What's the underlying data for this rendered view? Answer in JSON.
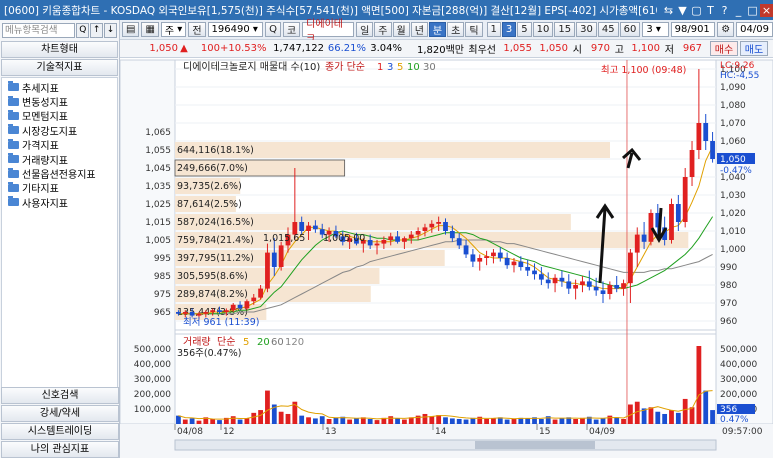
{
  "window": {
    "title": "[0600] 키움종합차트 - KOSDAQ 외국인보유[1,575(천)] 주식수[57,541(천)] 액면[500] 자본금[288(억)] 결산[12월] EPS[-402] 시가총액[610(억)]",
    "buttons": [
      "⇆",
      "▼",
      "▢",
      "T",
      "?",
      "_",
      "□",
      "×"
    ]
  },
  "left_panel": {
    "search_placeholder": "메뉴항목검색",
    "search_btn": "Q",
    "up_btn": "↑",
    "down_btn": "↓",
    "chart_type_label": "차트형태",
    "tech_indicator_label": "기술적지표",
    "tree_items": [
      "추세지표",
      "변동성지표",
      "모멘텀지표",
      "시장강도지표",
      "가격지표",
      "거래량지표",
      "선물옵션전용지표",
      "기타지표",
      "사용자지표"
    ],
    "bottom_buttons": [
      "신호검색",
      "강세/약세",
      "시스템트레이딩",
      "나의 관심지표"
    ]
  },
  "toolbar1": {
    "icons": [
      "▤",
      "▦"
    ],
    "period": "주",
    "period2": "전",
    "code": "196490",
    "search_icon": "Q",
    "market": "코",
    "name": "디에이테크",
    "intervals": [
      "일",
      "주",
      "월",
      "년",
      "분",
      "초",
      "틱"
    ],
    "selected_interval": "분",
    "minute_options": [
      "1",
      "3",
      "5",
      "10",
      "15",
      "30",
      "45",
      "60"
    ],
    "selected_minute": "3",
    "count": "3",
    "page": "98/901",
    "date": "04/09"
  },
  "toolbar2": {
    "price": "1,050",
    "change_arrow": "▲",
    "change": "100",
    "change_pct": "+10.53%",
    "volume": "1,747,122",
    "vol_ratio": "66.21%",
    "turnover": "3.04%",
    "amount": "1,820백만",
    "best_label": "최우선",
    "ask": "1,055",
    "bid": "1,050",
    "open_label": "시",
    "open": "970",
    "high_label": "고",
    "high": "1,100",
    "low_label": "저",
    "low": "967",
    "buy_label": "매수",
    "sell_label": "매도"
  },
  "chart": {
    "legend_title": "디에이테크놀로지 매물대 수(10)",
    "ma_label": "종가 단순",
    "ma_periods": [
      "1",
      "3",
      "5",
      "10",
      "30"
    ],
    "ma_colors": [
      "#e02020",
      "#1a4fd1",
      "#e0a000",
      "#20a020",
      "#777777"
    ],
    "high_note": "최고 1,100 (09:48)",
    "low_note": "최저 961 (11:39)",
    "lc_label": "LC:9,26",
    "hc_label": "HC:-4,55",
    "price_ticks": [
      "1,100",
      "1,090",
      "1,080",
      "1,070",
      "1,060",
      "1,050",
      "1,040",
      "1,030",
      "1,020",
      "1,010",
      "1,000",
      "990",
      "980",
      "970",
      "960"
    ],
    "left_ticks": [
      "1,065",
      "1,055",
      "1,045",
      "1,035",
      "1,025",
      "1,015",
      "1,005",
      "995",
      "985",
      "975",
      "965"
    ],
    "current_price_tag": "1,050",
    "current_pct_tag": "-0.47%",
    "volume_profile": [
      {
        "label": "644,116(18.1%)",
        "price": 1055,
        "ratio": 1.0
      },
      {
        "label": "249,666(7.0%)",
        "price": 1045,
        "ratio": 0.39
      },
      {
        "label": "93,735(2.6%)",
        "price": 1035,
        "ratio": 0.15
      },
      {
        "label": "87,614(2.5%)",
        "price": 1025,
        "ratio": 0.14
      },
      {
        "label": "587,024(16.5%)",
        "price": 1015,
        "ratio": 0.91
      },
      {
        "label": "759,784(21.4%)",
        "price": 1005,
        "ratio": 1.18
      },
      {
        "label": "397,795(11.2%)",
        "price": 995,
        "ratio": 0.62
      },
      {
        "label": "305,595(8.6%)",
        "price": 985,
        "ratio": 0.47
      },
      {
        "label": "289,874(8.2%)",
        "price": 975,
        "ratio": 0.45
      },
      {
        "label": "135,447(3.8%)",
        "price": 965,
        "ratio": 0.21
      }
    ],
    "inline_labels": [
      "1,015,65",
      "1,005,00"
    ],
    "volume_legend": "거래량",
    "volume_ma_label": "단순",
    "volume_ma_periods": [
      "5",
      "20",
      "60",
      "120"
    ],
    "volume_ma_colors": [
      "#e0a000",
      "#20a020",
      "#777777"
    ],
    "volume_note": "356주(0.47%)",
    "volume_ticks": [
      "500,000",
      "400,000",
      "300,000",
      "200,000",
      "100,000"
    ],
    "volume_tag": "356",
    "volume_pct_tag": "0.47%",
    "x_labels": [
      "04/08",
      "12",
      "13",
      "14",
      "15",
      "04/09"
    ],
    "time_label": "09:57:00"
  },
  "chart_data": {
    "type": "candlestick",
    "ylim": [
      955,
      1105
    ],
    "candles": [
      [
        965,
        966,
        963,
        964
      ],
      [
        964,
        966,
        962,
        965
      ],
      [
        965,
        967,
        962,
        963
      ],
      [
        963,
        965,
        961,
        964
      ],
      [
        964,
        966,
        962,
        965
      ],
      [
        965,
        967,
        963,
        966
      ],
      [
        966,
        968,
        964,
        965
      ],
      [
        965,
        967,
        963,
        966
      ],
      [
        966,
        970,
        965,
        969
      ],
      [
        969,
        971,
        966,
        967
      ],
      [
        967,
        972,
        966,
        971
      ],
      [
        971,
        975,
        969,
        973
      ],
      [
        973,
        980,
        972,
        978
      ],
      [
        978,
        1003,
        976,
        998
      ],
      [
        998,
        1006,
        985,
        990
      ],
      [
        990,
        1004,
        988,
        1002
      ],
      [
        1002,
        1012,
        998,
        1008
      ],
      [
        1008,
        1045,
        1005,
        1015
      ],
      [
        1015,
        1018,
        1008,
        1010
      ],
      [
        1010,
        1015,
        1005,
        1013
      ],
      [
        1013,
        1016,
        1009,
        1011
      ],
      [
        1011,
        1014,
        1006,
        1008
      ],
      [
        1008,
        1012,
        1004,
        1010
      ],
      [
        1010,
        1013,
        1006,
        1007
      ],
      [
        1007,
        1010,
        1002,
        1004
      ],
      [
        1004,
        1008,
        1000,
        1006
      ],
      [
        1006,
        1009,
        1002,
        1003
      ],
      [
        1003,
        1006,
        998,
        1005
      ],
      [
        1005,
        1008,
        1000,
        1002
      ],
      [
        1002,
        1005,
        997,
        1003
      ],
      [
        1003,
        1007,
        1000,
        1005
      ],
      [
        1005,
        1009,
        1002,
        1007
      ],
      [
        1007,
        1010,
        1003,
        1004
      ],
      [
        1004,
        1007,
        1000,
        1006
      ],
      [
        1006,
        1010,
        1003,
        1008
      ],
      [
        1008,
        1012,
        1005,
        1010
      ],
      [
        1010,
        1014,
        1007,
        1012
      ],
      [
        1012,
        1016,
        1009,
        1014
      ],
      [
        1014,
        1018,
        1010,
        1015
      ],
      [
        1015,
        1017,
        1008,
        1010
      ],
      [
        1010,
        1013,
        1004,
        1006
      ],
      [
        1006,
        1009,
        1000,
        1002
      ],
      [
        1002,
        1005,
        995,
        997
      ],
      [
        997,
        1000,
        990,
        993
      ],
      [
        993,
        997,
        988,
        995
      ],
      [
        995,
        999,
        991,
        996
      ],
      [
        996,
        1000,
        992,
        998
      ],
      [
        998,
        1001,
        993,
        995
      ],
      [
        995,
        998,
        989,
        991
      ],
      [
        991,
        995,
        987,
        993
      ],
      [
        993,
        996,
        988,
        990
      ],
      [
        990,
        994,
        985,
        988
      ],
      [
        988,
        992,
        983,
        986
      ],
      [
        986,
        990,
        980,
        983
      ],
      [
        983,
        987,
        978,
        981
      ],
      [
        981,
        986,
        976,
        984
      ],
      [
        984,
        988,
        979,
        982
      ],
      [
        982,
        986,
        975,
        978
      ],
      [
        978,
        983,
        972,
        980
      ],
      [
        980,
        985,
        976,
        982
      ],
      [
        982,
        988,
        977,
        979
      ],
      [
        979,
        984,
        974,
        977
      ],
      [
        977,
        982,
        970,
        975
      ],
      [
        975,
        982,
        972,
        980
      ],
      [
        980,
        985,
        976,
        978
      ],
      [
        978,
        983,
        974,
        981
      ],
      [
        981,
        1000,
        970,
        998
      ],
      [
        998,
        1012,
        990,
        1008
      ],
      [
        1008,
        1015,
        1000,
        1004
      ],
      [
        1004,
        1022,
        1002,
        1020
      ],
      [
        1020,
        1025,
        1008,
        1012
      ],
      [
        1012,
        1018,
        1002,
        1005
      ],
      [
        1005,
        1028,
        1003,
        1025
      ],
      [
        1025,
        1030,
        1010,
        1015
      ],
      [
        1015,
        1045,
        1012,
        1040
      ],
      [
        1040,
        1060,
        1035,
        1055
      ],
      [
        1055,
        1100,
        1050,
        1070
      ],
      [
        1070,
        1075,
        1055,
        1060
      ],
      [
        1060,
        1065,
        1048,
        1050
      ]
    ],
    "volumes": [
      15,
      8,
      10,
      6,
      12,
      9,
      7,
      11,
      14,
      8,
      10,
      20,
      25,
      60,
      35,
      22,
      18,
      40,
      15,
      12,
      10,
      14,
      9,
      11,
      13,
      8,
      10,
      12,
      9,
      7,
      11,
      14,
      10,
      8,
      12,
      15,
      18,
      14,
      16,
      12,
      10,
      9,
      8,
      11,
      13,
      9,
      10,
      12,
      8,
      9,
      11,
      10,
      12,
      9,
      14,
      8,
      10,
      12,
      9,
      11,
      13,
      8,
      10,
      15,
      12,
      9,
      35,
      40,
      28,
      30,
      22,
      18,
      25,
      20,
      45,
      30,
      140,
      60,
      25
    ],
    "ma5": [
      964,
      964,
      964,
      964,
      964,
      965,
      965,
      965,
      966,
      967,
      968,
      970,
      972,
      980,
      985,
      991,
      999,
      1004,
      1008,
      1012,
      1012,
      1011,
      1010,
      1010,
      1008,
      1007,
      1006,
      1005,
      1004,
      1004,
      1004,
      1004,
      1005,
      1005,
      1006,
      1007,
      1009,
      1011,
      1013,
      1013,
      1012,
      1009,
      1006,
      1002,
      998,
      996,
      995,
      995,
      995,
      994,
      993,
      992,
      990,
      987,
      984,
      983,
      982,
      981,
      981,
      980,
      980,
      979,
      978,
      978,
      978,
      978,
      983,
      990,
      997,
      1004,
      1008,
      1009,
      1012,
      1013,
      1018,
      1026,
      1035,
      1049,
      1057
    ],
    "ma10": [
      964,
      964,
      964,
      964,
      964,
      964,
      964,
      965,
      965,
      966,
      966,
      967,
      968,
      972,
      976,
      979,
      984,
      989,
      994,
      998,
      1002,
      1005,
      1007,
      1009,
      1010,
      1009,
      1008,
      1008,
      1007,
      1006,
      1006,
      1005,
      1005,
      1005,
      1005,
      1005,
      1006,
      1007,
      1008,
      1009,
      1009,
      1009,
      1009,
      1008,
      1006,
      1005,
      1003,
      1001,
      999,
      997,
      995,
      994,
      993,
      991,
      990,
      989,
      988,
      987,
      986,
      985,
      984,
      982,
      981,
      980,
      979,
      978,
      979,
      980,
      982,
      984,
      986,
      988,
      991,
      994,
      997,
      1001,
      1006,
      1012,
      1018
    ],
    "ma30": [
      964,
      964,
      964,
      964,
      964,
      964,
      964,
      964,
      964,
      965,
      965,
      965,
      966,
      967,
      968,
      969,
      971,
      973,
      975,
      977,
      979,
      981,
      983,
      985,
      987,
      988,
      990,
      991,
      993,
      994,
      995,
      996,
      997,
      998,
      999,
      1000,
      1001,
      1002,
      1003,
      1004,
      1004,
      1005,
      1005,
      1005,
      1005,
      1005,
      1004,
      1004,
      1003,
      1003,
      1002,
      1001,
      1000,
      999,
      998,
      997,
      996,
      995,
      994,
      993,
      992,
      991,
      990,
      989,
      988,
      987,
      987,
      987,
      987,
      988,
      988,
      989,
      989,
      990,
      991,
      992,
      993,
      995,
      997
    ]
  }
}
